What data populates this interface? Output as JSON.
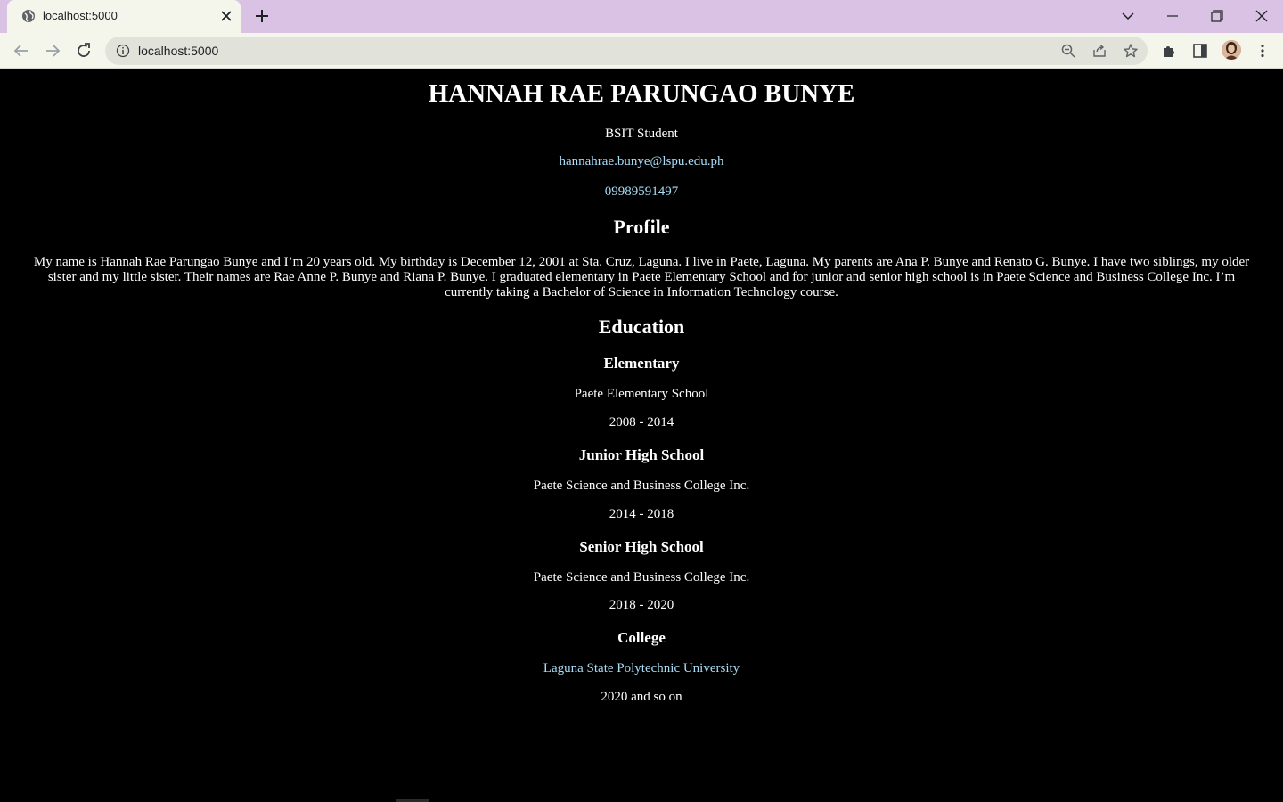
{
  "browser": {
    "tab_title": "localhost:5000",
    "url": "localhost:5000"
  },
  "resume": {
    "name": "HANNAH RAE PARUNGAO BUNYE",
    "role": "BSIT Student",
    "email": "hannahrae.bunye@lspu.edu.ph",
    "phone": "09989591497",
    "profile_heading": "Profile",
    "profile_text": "My name is Hannah Rae Parungao Bunye and I’m 20 years old. My birthday is December 12, 2001 at Sta. Cruz, Laguna. I live in Paete, Laguna. My parents are Ana P. Bunye and Renato G. Bunye. I have two siblings, my older sister and my little sister. Their names are Rae Anne P. Bunye and Riana P. Bunye. I graduated elementary in Paete Elementary School and for junior and senior high school is in Paete Science and Business College Inc. I’m currently taking a Bachelor of Science in Information Technology course.",
    "education_heading": "Education",
    "education": [
      {
        "level": "Elementary",
        "school": "Paete Elementary School",
        "years": "2008 - 2014"
      },
      {
        "level": "Junior High School",
        "school": "Paete Science and Business College Inc.",
        "years": "2014 - 2018"
      },
      {
        "level": "Senior High School",
        "school": "Paete Science and Business College Inc.",
        "years": "2018 - 2020"
      },
      {
        "level": "College",
        "school": "Laguna State Polytechnic University",
        "years": "2020 and so on"
      }
    ]
  },
  "icons": {
    "favicon": "globe-icon",
    "tab_close": "close-icon",
    "new_tab": "plus-icon",
    "tab_search": "chevron-down-icon",
    "minimize": "minimize-icon",
    "restore": "restore-icon",
    "close_window": "close-icon",
    "back": "back-arrow-icon",
    "forward": "forward-arrow-icon",
    "reload": "reload-icon",
    "site_info": "info-icon",
    "zoom": "zoom-out-icon",
    "share": "share-icon",
    "bookmark": "star-icon",
    "extensions": "puzzle-icon",
    "side_panel": "side-panel-icon",
    "profile": "avatar",
    "menu": "kebab-menu-icon"
  },
  "colors": {
    "tabbar_bg": "#d9c2e4",
    "page_bg": "#000000",
    "link": "#a8dcf5"
  }
}
